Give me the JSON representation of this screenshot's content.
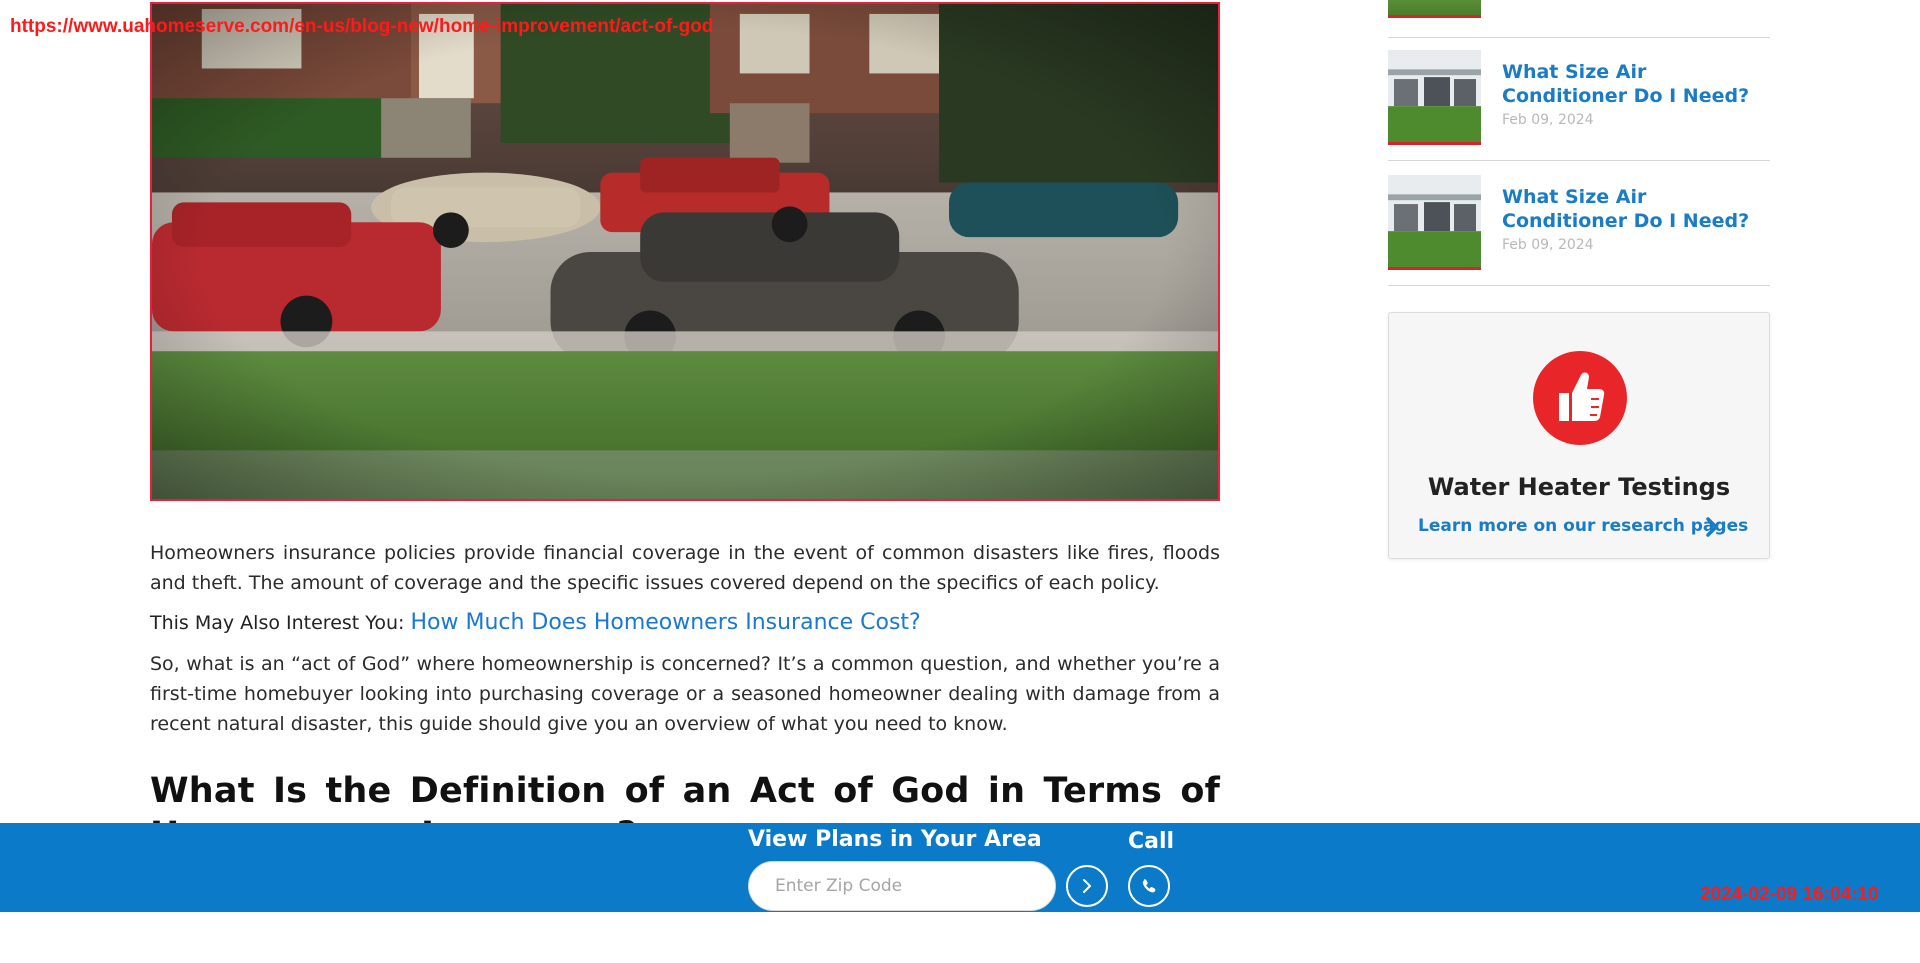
{
  "overlay": {
    "url": "https://www.uahomeserve.com/en-us/blog-new/home-improvement/act-of-god",
    "timestamp": "2024-02-09 16:04:10"
  },
  "hero": {
    "image_desc_icon": "hail-damaged-cars-photo"
  },
  "article": {
    "paragraph_1": "Homeowners insurance policies provide financial coverage in the event of common disasters like fires, floods and theft. The amount of coverage and the specific issues covered depend on the specifics of each policy.",
    "interest_prefix": "This May Also Interest You: ",
    "interest_link": "How Much Does Homeowners Insurance Cost?",
    "paragraph_2": "So, what is an “act of God” where homeownership is concerned? It’s a common question, and whether you’re a first-time homebuyer looking into purchasing coverage or a seasoned homeowner dealing with damage from a recent natural disaster, this guide should give you an overview of what you need to know.",
    "heading": "What Is the Definition of an Act of God in Terms of Homeowners Insurance?"
  },
  "sidebar": {
    "items": [
      {
        "title": "What Size Air Conditioner Do I Need?",
        "date": "Feb 09, 2024"
      },
      {
        "title": "What Size Air Conditioner Do I Need?",
        "date": "Feb 09, 2024"
      }
    ],
    "cta": {
      "title": "Water Heater Testings",
      "link": "Learn more on our research pages",
      "icon": "thumbs-up-icon"
    }
  },
  "footer_bar": {
    "label": "View Plans in Your Area",
    "zip_placeholder": "Enter Zip Code",
    "call_label": "Call",
    "go_icon": "chevron-right-icon",
    "call_icon": "phone-icon"
  },
  "colors": {
    "link_blue": "#1a78d4",
    "sidebar_blue": "#1a7cc6",
    "footer_blue": "#0b7bc9",
    "accent_red": "#e8262a"
  }
}
